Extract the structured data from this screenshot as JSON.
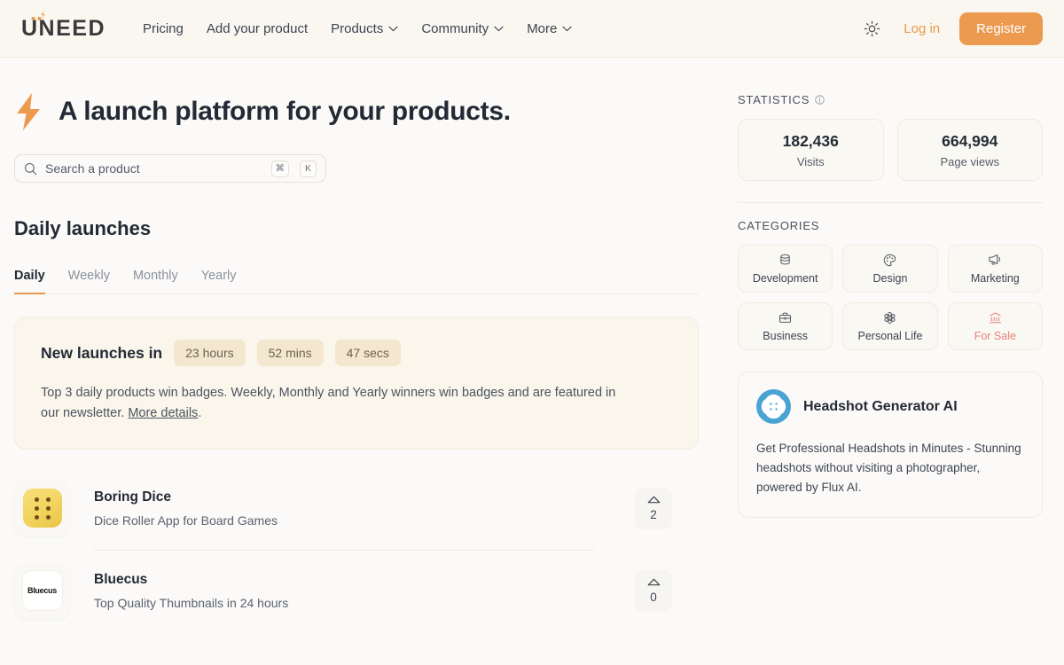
{
  "header": {
    "logo_text": "UNEED",
    "nav": [
      {
        "label": "Pricing",
        "has_dropdown": false
      },
      {
        "label": "Add your product",
        "has_dropdown": false
      },
      {
        "label": "Products",
        "has_dropdown": true
      },
      {
        "label": "Community",
        "has_dropdown": true
      },
      {
        "label": "More",
        "has_dropdown": true
      }
    ],
    "theme_icon": "sun-icon",
    "login_label": "Log in",
    "register_label": "Register",
    "accent_color": "#ec9a50"
  },
  "hero": {
    "icon": "lightning-bolt-icon",
    "title": "A launch platform for your products.",
    "search_placeholder": "Search a product",
    "search_value": "",
    "search_icon": "search-icon",
    "shortcut_keys": [
      "⌘",
      "K"
    ]
  },
  "launches": {
    "section_title": "Daily launches",
    "tabs": [
      {
        "label": "Daily",
        "active": true
      },
      {
        "label": "Weekly",
        "active": false
      },
      {
        "label": "Monthly",
        "active": false
      },
      {
        "label": "Yearly",
        "active": false
      }
    ]
  },
  "banner": {
    "title": "New launches in",
    "countdown": [
      "23 hours",
      "52 mins",
      "47 secs"
    ],
    "description_pre": "Top 3 daily products win badges. Weekly, Monthly and Yearly winners win badges and are featured in our newsletter. ",
    "link_label": "More details",
    "description_post": "."
  },
  "products": [
    {
      "name": "Boring Dice",
      "description": "Dice Roller App for Board Games",
      "upvotes": "2",
      "thumb": "dice-icon"
    },
    {
      "name": "Bluecus",
      "description": "Top Quality Thumbnails in 24 hours",
      "upvotes": "0",
      "thumb": "bluecus-wordmark"
    }
  ],
  "statistics": {
    "label": "STATISTICS",
    "info_icon": "info-icon",
    "cards": [
      {
        "value": "182,436",
        "label": "Visits"
      },
      {
        "value": "664,994",
        "label": "Page views"
      }
    ]
  },
  "categories": {
    "label": "CATEGORIES",
    "items": [
      {
        "label": "Development",
        "icon": "database-icon",
        "highlight": false
      },
      {
        "label": "Design",
        "icon": "palette-icon",
        "highlight": false
      },
      {
        "label": "Marketing",
        "icon": "megaphone-icon",
        "highlight": false
      },
      {
        "label": "Business",
        "icon": "briefcase-icon",
        "highlight": false
      },
      {
        "label": "Personal Life",
        "icon": "flower-icon",
        "highlight": false
      },
      {
        "label": "For Sale",
        "icon": "bank-icon",
        "highlight": true
      }
    ],
    "highlight_color": "#e8807e"
  },
  "promo": {
    "logo": "headshot-generator-logo",
    "title": "Headshot Generator AI",
    "text": "Get Professional Headshots in Minutes - Stunning headshots without visiting a photographer, powered by Flux AI."
  }
}
